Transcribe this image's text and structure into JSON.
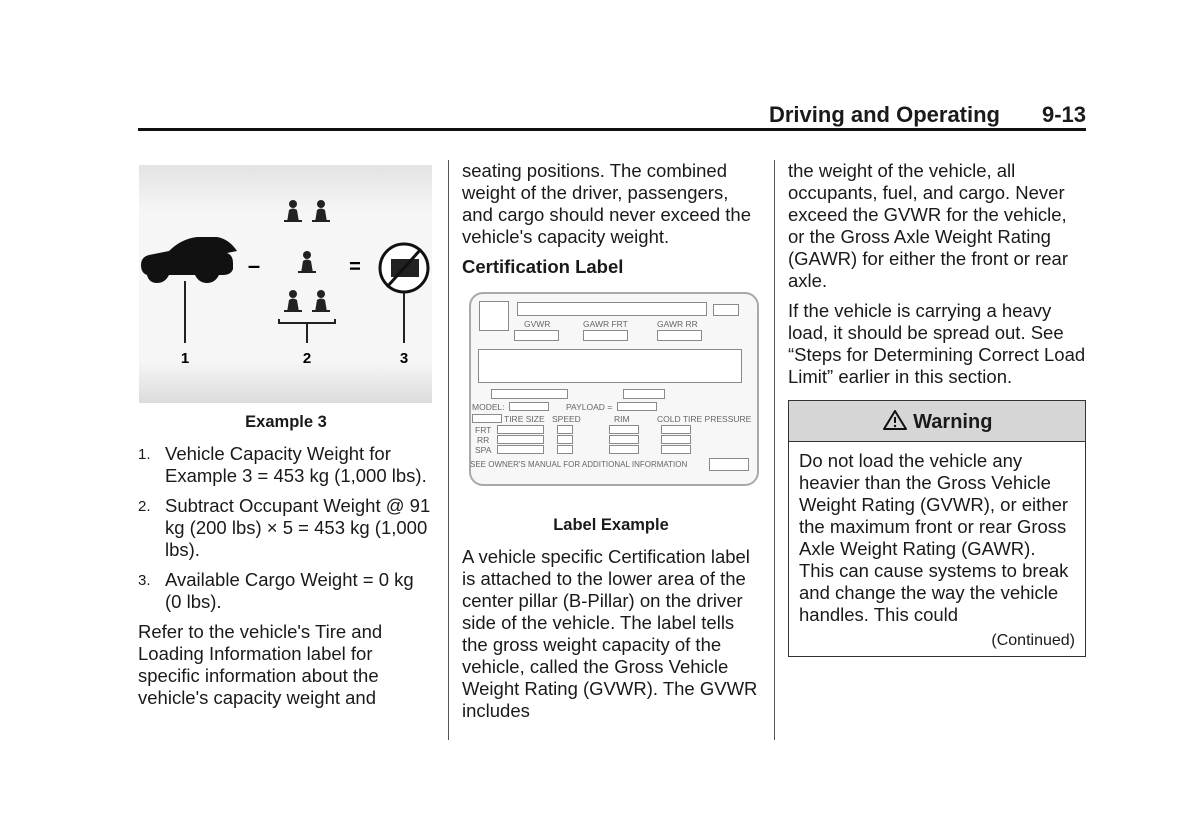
{
  "header": {
    "section_title": "Driving and Operating",
    "page_number": "9-13"
  },
  "column1": {
    "figure": {
      "callouts": [
        "1",
        "2",
        "3"
      ],
      "minus_sign": "–",
      "equals_sign": "=",
      "caption": "Example 3"
    },
    "steps": [
      {
        "num": "1.",
        "text": "Vehicle Capacity Weight for Example 3 = 453 kg (1,000 lbs)."
      },
      {
        "num": "2.",
        "text": "Subtract Occupant Weight @ 91 kg (200 lbs) × 5 = 453 kg (1,000 lbs)."
      },
      {
        "num": "3.",
        "text": "Available Cargo Weight = 0 kg (0 lbs)."
      }
    ],
    "paragraph": "Refer to the vehicle's Tire and Loading Information label for specific information about the vehicle's capacity weight and"
  },
  "column2": {
    "paragraph1": "seating positions. The combined weight of the driver, passengers, and cargo should never exceed the vehicle's capacity weight.",
    "subheading": "Certification Label",
    "label_figure": {
      "gvwr": "GVWR",
      "gawr_frt": "GAWR FRT",
      "gawr_rr": "GAWR RR",
      "model": "MODEL:",
      "payload": "PAYLOAD =",
      "tire_size": "TIRE SIZE",
      "speed": "SPEED",
      "rim": "RIM",
      "cold_tire_pressure": "COLD TIRE PRESSURE",
      "frt": "FRT",
      "rr": "RR",
      "spa": "SPA",
      "footer": "SEE OWNER'S MANUAL FOR ADDITIONAL INFORMATION"
    },
    "caption": "Label Example",
    "paragraph2": "A vehicle specific Certification label is attached to the lower area of the center pillar (B-Pillar) on the driver side of the vehicle. The label tells the gross weight capacity of the vehicle, called the Gross Vehicle Weight Rating (GVWR). The GVWR includes"
  },
  "column3": {
    "paragraph1": "the weight of the vehicle, all occupants, fuel, and cargo. Never exceed the GVWR for the vehicle, or the Gross Axle Weight Rating (GAWR) for either the front or rear axle.",
    "paragraph2": "If the vehicle is carrying a heavy load, it should be spread out. See “Steps for Determining Correct Load Limit” earlier in this section.",
    "warning": {
      "icon": "warning-triangle-icon",
      "title": "Warning",
      "body": "Do not load the vehicle any heavier than the Gross Vehicle Weight Rating (GVWR), or either the maximum front or rear Gross Axle Weight Rating (GAWR). This can cause systems to break and change the way the vehicle handles. This could",
      "continued": "(Continued)"
    }
  }
}
